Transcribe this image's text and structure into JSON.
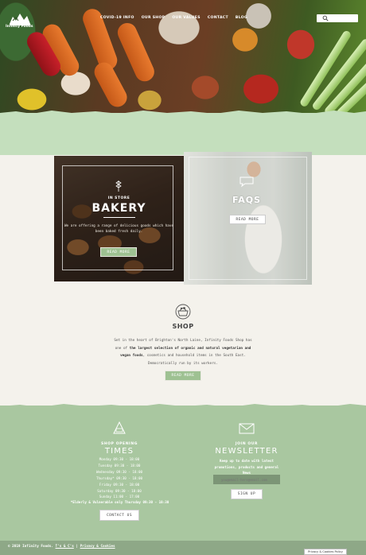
{
  "brand": {
    "name": "Infinity Foods"
  },
  "nav": {
    "items": [
      "COVID-19 INFO",
      "OUR SHOP",
      "OUR VALUES",
      "CONTACT",
      "BLOG"
    ]
  },
  "bakery": {
    "kicker": "IN STORE",
    "title": "BAKERY",
    "desc": "We are offering a range of delicious goods which have been baked fresh daily.",
    "button": "READ MORE"
  },
  "faqs": {
    "title": "FAQS",
    "button": "READ MORE"
  },
  "shop": {
    "title": "SHOP",
    "text_1": "Set in the heart of Brighton's North Laine, Infinity Foods Shop has one of ",
    "text_bold_1": "the largest selection of organic and natural vegetarian and vegan foods",
    "text_2": ", cosmetics and household items in the South East. Democratically run by its workers.",
    "button": "READ MORE"
  },
  "hours": {
    "kicker": "SHOP OPENING",
    "title": "TIMES",
    "days": [
      "Monday 09:30 - 18:00",
      "Tuesday 09:30 - 18:00",
      "Wednesday 09:30 - 18:00",
      "Thursday* 09:30 - 18:00",
      "Friday 09:30 - 18:00",
      "Saturday 09:30 - 18:00",
      "Sunday 11:00 - 17:00"
    ],
    "note": "*Elderly & Vulnerable only Thursday 09:30 - 10:30",
    "button": "CONTACT US"
  },
  "newsletter": {
    "kicker": "JOIN OUR",
    "title": "NEWSLETTER",
    "desc": "Keep up to date with latest promotions, products and general News",
    "email_placeholder": "you@email-here@email.com",
    "button": "SIGN UP"
  },
  "footer": {
    "copyright": "© 2019 Infinity Foods.",
    "terms": "T's & C's",
    "separator": "|",
    "privacy": "Privacy & Cookies",
    "privacy_badge": "Privacy & Cookies Policy"
  },
  "colors": {
    "sage": "#a9c7a0",
    "mint": "#c4dfbd",
    "button_green": "#9ec192",
    "cream": "#f4f2ec"
  }
}
